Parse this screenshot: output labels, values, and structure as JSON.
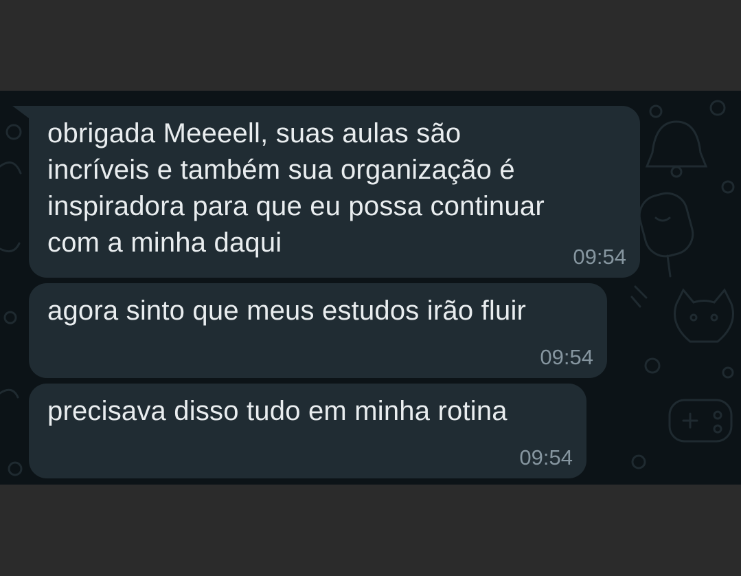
{
  "messages": [
    {
      "text": "obrigada Meeeell, suas aulas são\nincríveis e também sua organização é\ninspiradora para que eu possa continuar\ncom a minha daqui",
      "time": "09:54"
    },
    {
      "text": "agora sinto que meus estudos irão fluir",
      "time": "09:54"
    },
    {
      "text": "precisava disso tudo em minha rotina",
      "time": "09:54"
    }
  ],
  "colors": {
    "chat_background": "#0c1317",
    "bubble_incoming": "#202c33",
    "message_text": "#e9edef",
    "timestamp": "#8696a0",
    "letterbox": "#2b2b2b"
  },
  "icons": [
    "doodle-wallpaper-pattern",
    "bell-doodle-icon",
    "cat-doodle-icon",
    "gamepad-doodle-icon",
    "popsicle-doodle-icon"
  ]
}
